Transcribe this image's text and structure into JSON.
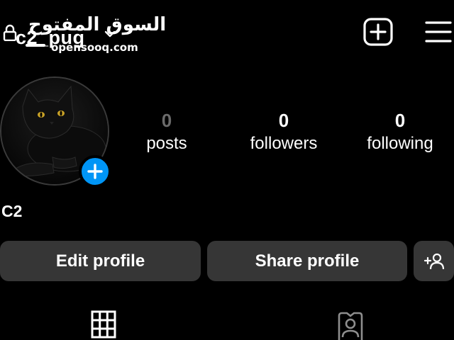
{
  "header": {
    "username": "c2_pug",
    "watermark_arabic": "السوق المفتوح",
    "watermark_latin": "opensooq.com",
    "icons": {
      "lock": "lock-icon",
      "chevron": "chevron-down-icon",
      "new_post": "plus-square-icon",
      "menu": "hamburger-menu-icon"
    }
  },
  "profile": {
    "name": "C2",
    "avatar": "black cat photo",
    "stats": [
      {
        "value": "0",
        "label": "posts"
      },
      {
        "value": "0",
        "label": "followers"
      },
      {
        "value": "0",
        "label": "following"
      }
    ]
  },
  "actions": {
    "edit_label": "Edit profile",
    "share_label": "Share profile",
    "add_person_icon": "add-person-icon"
  },
  "tabs": [
    {
      "icon": "grid-icon"
    },
    {
      "icon": "tagged-person-icon"
    }
  ],
  "colors": {
    "background": "#000000",
    "button": "#363636",
    "accent": "#0095f6",
    "muted": "#6b6b6b"
  }
}
